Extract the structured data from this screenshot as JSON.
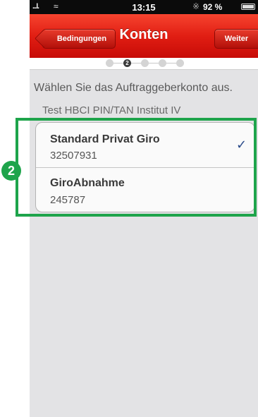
{
  "status_bar": {
    "signal": "...l.",
    "time": "13:15",
    "battery": "92 %"
  },
  "nav": {
    "title": "Konten",
    "back_label": "Bedingungen",
    "forward_label": "Weiter"
  },
  "steps": {
    "count": 5,
    "active_index": 1,
    "active_label": "2"
  },
  "content": {
    "instruction": "Wählen Sie das Auftraggeberkonto aus.",
    "section_header": "Test HBCI PIN/TAN Institut IV",
    "accounts": [
      {
        "name": "Standard Privat Giro",
        "number": "32507931",
        "selected": true,
        "check": "✓"
      },
      {
        "name": "GiroAbnahme",
        "number": "245787",
        "selected": false
      }
    ]
  },
  "annotation": {
    "badge": "2",
    "color": "#1ea44b"
  }
}
